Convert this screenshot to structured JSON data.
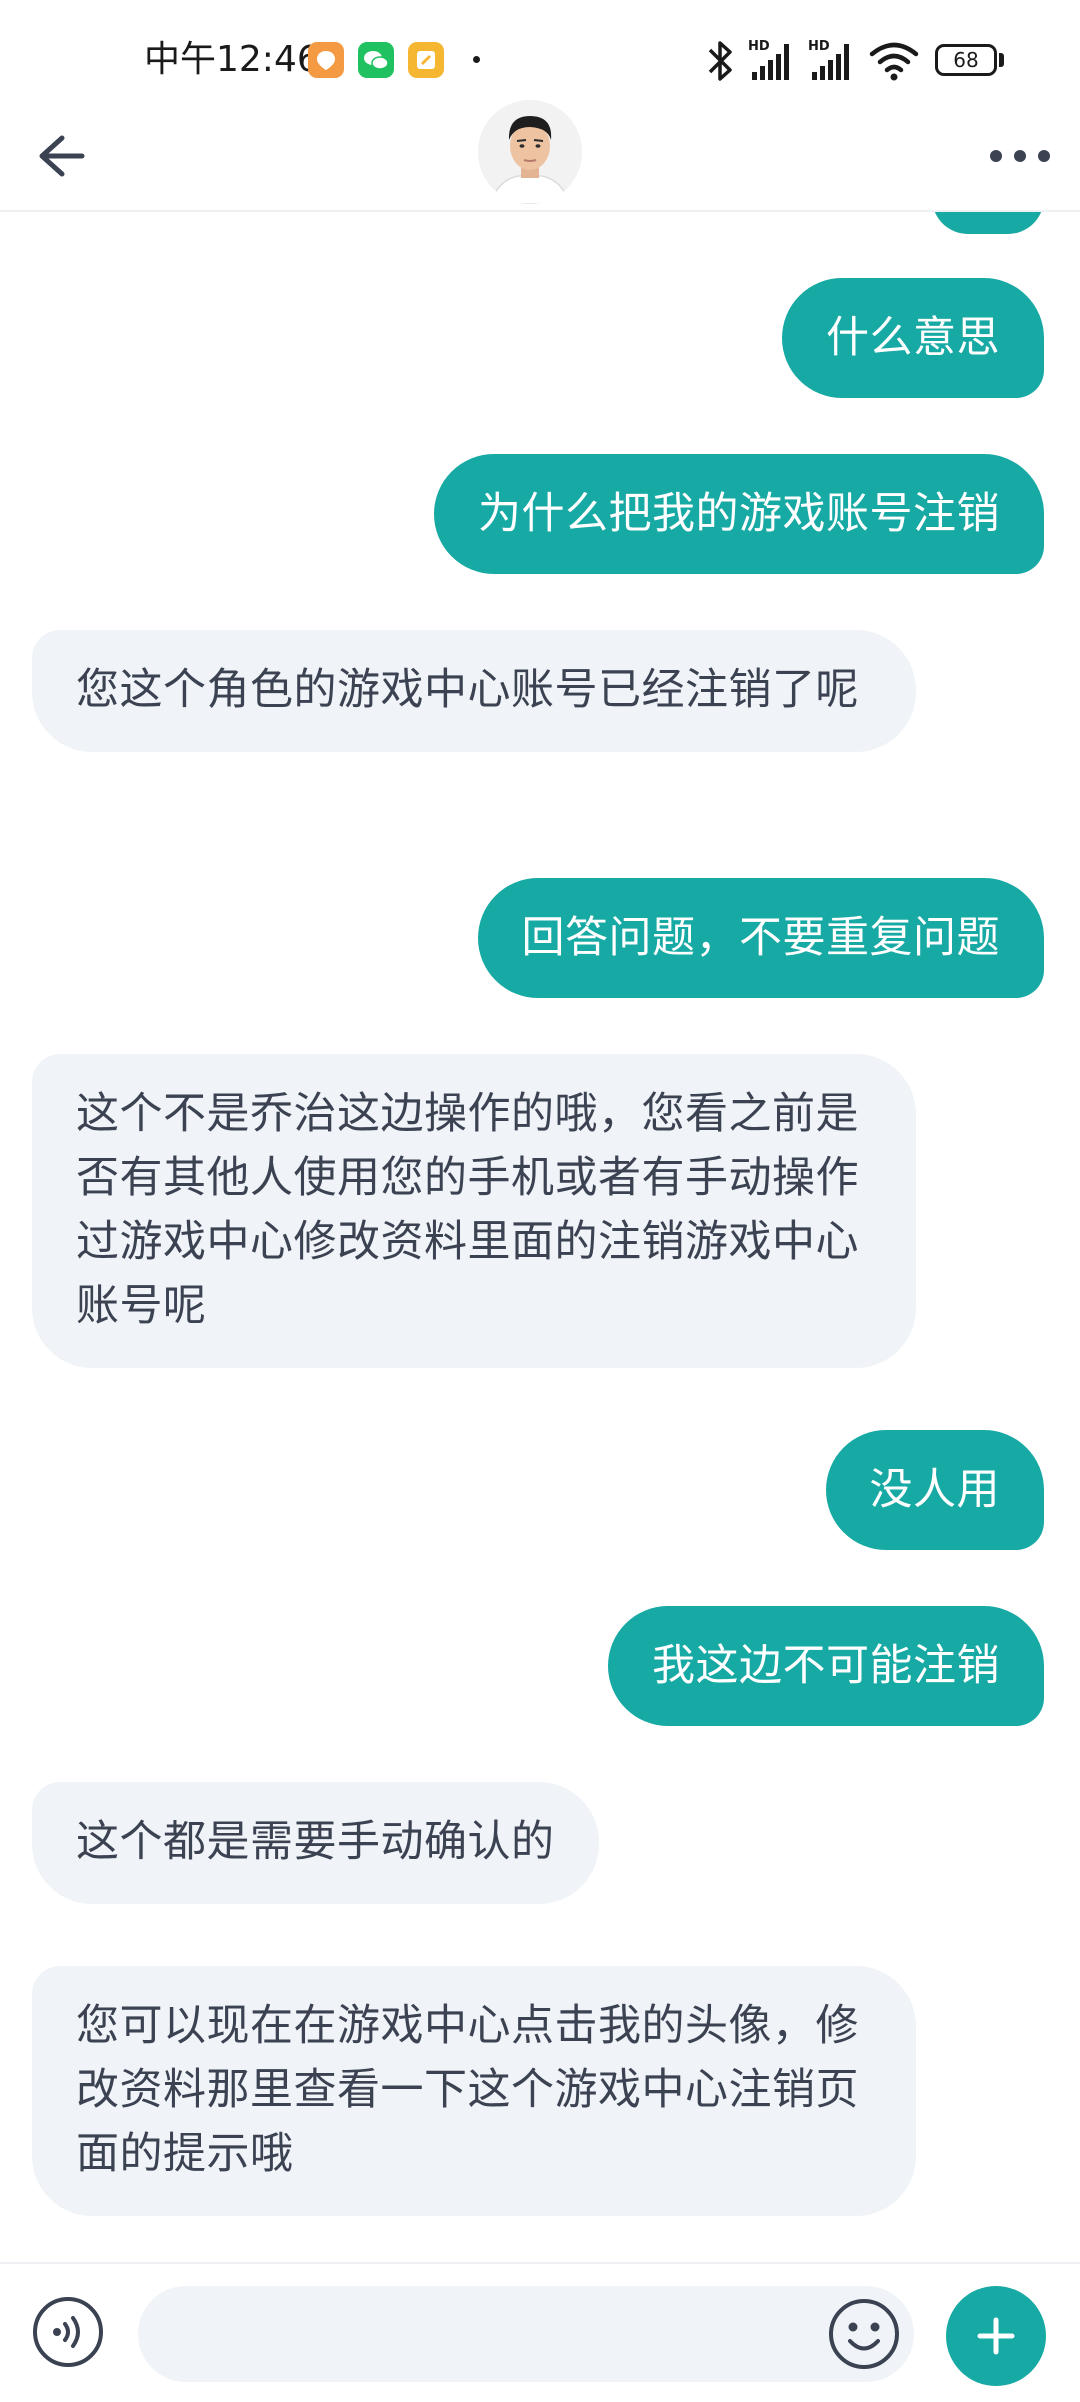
{
  "status_bar": {
    "time": "中午12:46",
    "battery": "68",
    "icons": [
      "notification-app-icon",
      "wechat-icon",
      "notes-app-icon",
      "bluetooth-icon",
      "signal-hd-icon",
      "signal-hd-icon",
      "wifi-icon",
      "battery-icon"
    ]
  },
  "header": {
    "back_icon": "arrow-left-icon",
    "avatar": "contact-avatar",
    "more_icon": "more-dots-icon"
  },
  "messages": [
    {
      "side": "sent",
      "text": "什么意思"
    },
    {
      "side": "sent",
      "text": "为什么把我的游戏账号注销"
    },
    {
      "side": "received",
      "text": "您这个角色的游戏中心账号已经注销了呢"
    },
    {
      "side": "sent",
      "text": "回答问题，不要重复问题"
    },
    {
      "side": "received",
      "text": "这个不是乔治这边操作的哦，您看之前是否有其他人使用您的手机或者有手动操作过游戏中心修改资料里面的注销游戏中心账号呢"
    },
    {
      "side": "sent",
      "text": "没人用"
    },
    {
      "side": "sent",
      "text": "我这边不可能注销"
    },
    {
      "side": "received",
      "text": "这个都是需要手动确认的"
    },
    {
      "side": "received",
      "text": "您可以现在在游戏中心点击我的头像，修改资料那里查看一下这个游戏中心注销页面的提示哦"
    }
  ],
  "input_bar": {
    "voice_icon": "voice-input-icon",
    "placeholder": "",
    "emoji_icon": "emoji-icon",
    "plus_icon": "plus-icon"
  },
  "colors": {
    "accent": "#17a9a3",
    "received_bubble": "#f0f3f7",
    "received_text": "#3b4252"
  }
}
